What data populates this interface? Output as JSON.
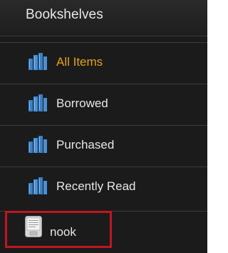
{
  "sidebar": {
    "title": "Bookshelves",
    "items": [
      {
        "label": "All Items",
        "icon": "bookshelf-icon",
        "selected": true
      },
      {
        "label": "Borrowed",
        "icon": "bookshelf-icon",
        "selected": false
      },
      {
        "label": "Purchased",
        "icon": "bookshelf-icon",
        "selected": false
      },
      {
        "label": "Recently Read",
        "icon": "bookshelf-icon",
        "selected": false
      },
      {
        "label": "nook",
        "icon": "ereader-device-icon",
        "selected": false
      }
    ]
  },
  "colors": {
    "panel_bg": "#1b1b1b",
    "selected_text": "#e3a21a",
    "icon_blue": "#3b7fc4",
    "highlight_red": "#c0161f"
  }
}
